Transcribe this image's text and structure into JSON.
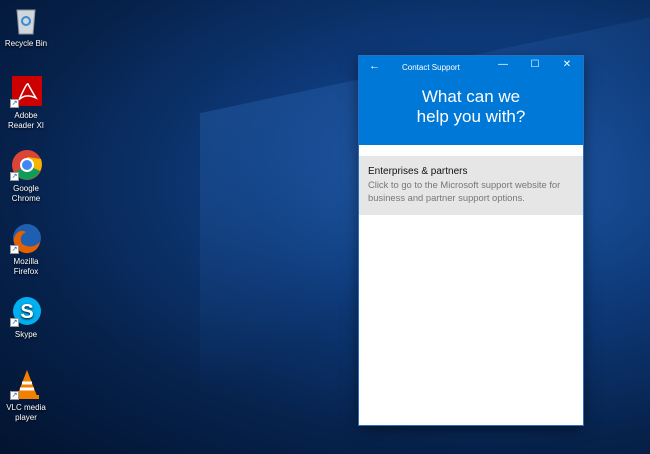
{
  "desktop": {
    "icons": [
      {
        "label": "Recycle Bin",
        "icon": "recycle-bin-icon",
        "shortcut": false
      },
      {
        "label": "Adobe Reader XI",
        "icon": "adobe-reader-icon",
        "shortcut": true
      },
      {
        "label": "Google Chrome",
        "icon": "chrome-icon",
        "shortcut": true
      },
      {
        "label": "Mozilla Firefox",
        "icon": "firefox-icon",
        "shortcut": true
      },
      {
        "label": "Skype",
        "icon": "skype-icon",
        "shortcut": true
      },
      {
        "label": "VLC media player",
        "icon": "vlc-icon",
        "shortcut": true
      }
    ]
  },
  "window": {
    "title": "Contact Support",
    "back": "←",
    "minimize": "—",
    "maximize": "☐",
    "close": "✕",
    "heading": "What can we help you with?",
    "items": [
      {
        "title": "Enterprises & partners",
        "description": "Click to go to the Microsoft support website for business and partner support options."
      }
    ],
    "accent": "#0078d7"
  }
}
